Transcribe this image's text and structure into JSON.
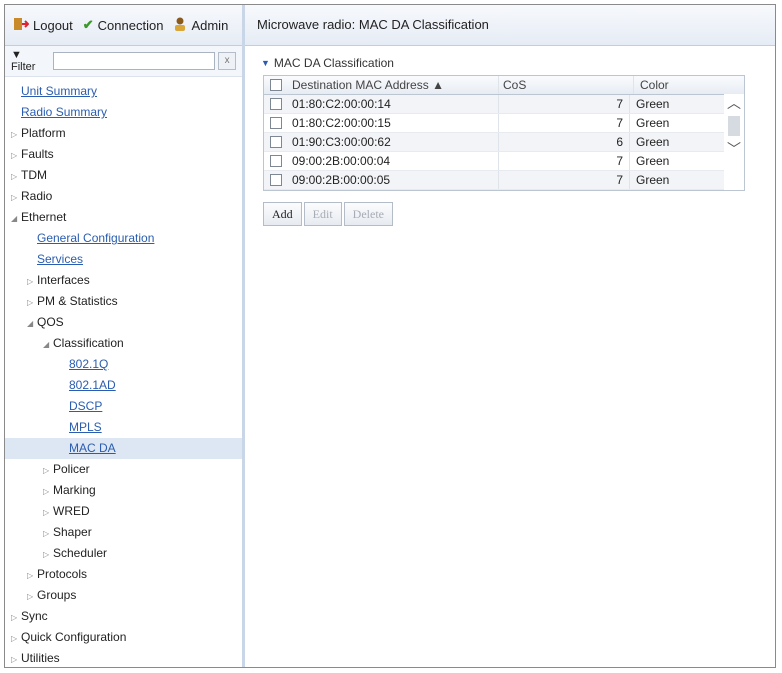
{
  "topbar": {
    "logout": "Logout",
    "connection": "Connection",
    "admin": "Admin"
  },
  "filter": {
    "label": "Filter",
    "value": "",
    "clear": "x"
  },
  "tree": [
    {
      "label": "Unit Summary",
      "level": 0,
      "link": true,
      "arrow": ""
    },
    {
      "label": "Radio Summary",
      "level": 0,
      "link": true,
      "arrow": ""
    },
    {
      "label": "Platform",
      "level": 0,
      "link": false,
      "arrow": "▷"
    },
    {
      "label": "Faults",
      "level": 0,
      "link": false,
      "arrow": "▷"
    },
    {
      "label": "TDM",
      "level": 0,
      "link": false,
      "arrow": "▷"
    },
    {
      "label": "Radio",
      "level": 0,
      "link": false,
      "arrow": "▷"
    },
    {
      "label": "Ethernet",
      "level": 0,
      "link": false,
      "arrow": "◢"
    },
    {
      "label": "General Configuration",
      "level": 1,
      "link": true,
      "arrow": ""
    },
    {
      "label": "Services",
      "level": 1,
      "link": true,
      "arrow": ""
    },
    {
      "label": "Interfaces",
      "level": 1,
      "link": false,
      "arrow": "▷"
    },
    {
      "label": "PM & Statistics",
      "level": 1,
      "link": false,
      "arrow": "▷"
    },
    {
      "label": "QOS",
      "level": 1,
      "link": false,
      "arrow": "◢"
    },
    {
      "label": "Classification",
      "level": 2,
      "link": false,
      "arrow": "◢"
    },
    {
      "label": "802.1Q",
      "level": 3,
      "link": true,
      "arrow": ""
    },
    {
      "label": "802.1AD",
      "level": 3,
      "link": true,
      "arrow": ""
    },
    {
      "label": "DSCP",
      "level": 3,
      "link": true,
      "arrow": ""
    },
    {
      "label": "MPLS",
      "level": 3,
      "link": true,
      "arrow": ""
    },
    {
      "label": "MAC DA",
      "level": 3,
      "link": true,
      "arrow": "",
      "selected": true
    },
    {
      "label": "Policer",
      "level": 2,
      "link": false,
      "arrow": "▷"
    },
    {
      "label": "Marking",
      "level": 2,
      "link": false,
      "arrow": "▷"
    },
    {
      "label": "WRED",
      "level": 2,
      "link": false,
      "arrow": "▷"
    },
    {
      "label": "Shaper",
      "level": 2,
      "link": false,
      "arrow": "▷"
    },
    {
      "label": "Scheduler",
      "level": 2,
      "link": false,
      "arrow": "▷"
    },
    {
      "label": "Protocols",
      "level": 1,
      "link": false,
      "arrow": "▷"
    },
    {
      "label": "Groups",
      "level": 1,
      "link": false,
      "arrow": "▷"
    },
    {
      "label": "Sync",
      "level": 0,
      "link": false,
      "arrow": "▷"
    },
    {
      "label": "Quick Configuration",
      "level": 0,
      "link": false,
      "arrow": "▷"
    },
    {
      "label": "Utilities",
      "level": 0,
      "link": false,
      "arrow": "▷"
    }
  ],
  "main": {
    "header": "Microwave radio: MAC DA Classification",
    "section_title": "MAC DA Classification",
    "columns": {
      "mac": "Destination MAC Address ▲",
      "cos": "CoS",
      "color": "Color"
    },
    "rows": [
      {
        "mac": "01:80:C2:00:00:14",
        "cos": "7",
        "color": "Green"
      },
      {
        "mac": "01:80:C2:00:00:15",
        "cos": "7",
        "color": "Green"
      },
      {
        "mac": "01:90:C3:00:00:62",
        "cos": "6",
        "color": "Green"
      },
      {
        "mac": "09:00:2B:00:00:04",
        "cos": "7",
        "color": "Green"
      },
      {
        "mac": "09:00:2B:00:00:05",
        "cos": "7",
        "color": "Green"
      }
    ],
    "buttons": {
      "add": "Add",
      "edit": "Edit",
      "delete": "Delete"
    }
  }
}
